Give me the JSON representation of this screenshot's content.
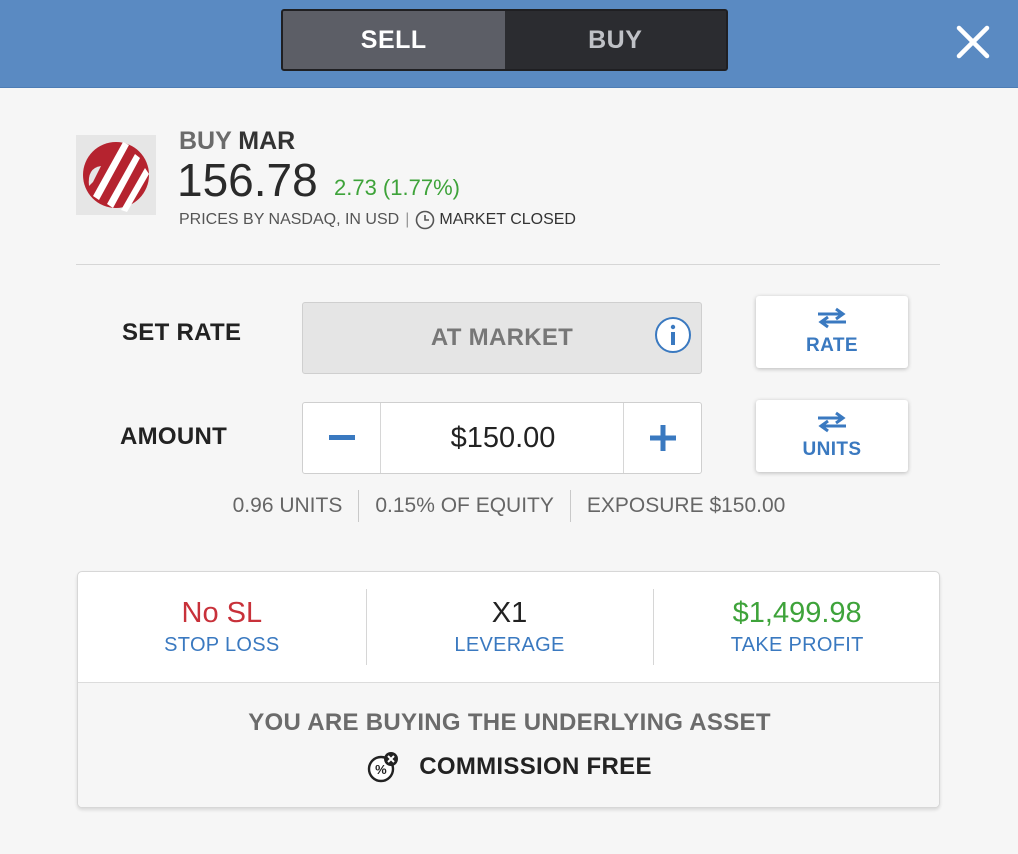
{
  "header": {
    "tabs": {
      "sell": "SELL",
      "buy": "BUY"
    }
  },
  "instrument": {
    "action": "BUY",
    "symbol": "MAR",
    "price": "156.78",
    "change": "2.73 (1.77%)",
    "prices_by": "PRICES BY NASDAQ, IN USD",
    "separator": "|",
    "market_status": "MARKET CLOSED"
  },
  "rate": {
    "label": "SET RATE",
    "value": "AT MARKET",
    "toggle_label": "RATE"
  },
  "amount": {
    "label": "AMOUNT",
    "value": "$150.00",
    "toggle_label": "UNITS"
  },
  "stats": {
    "units": "0.96 UNITS",
    "equity": "0.15% OF EQUITY",
    "exposure": "EXPOSURE $150.00"
  },
  "trade_settings": {
    "stop_loss": {
      "value": "No SL",
      "label": "STOP LOSS"
    },
    "leverage": {
      "value": "X1",
      "label": "LEVERAGE"
    },
    "take_profit": {
      "value": "$1,499.98",
      "label": "TAKE PROFIT"
    }
  },
  "footer": {
    "underlying": "YOU ARE BUYING THE UNDERLYING ASSET",
    "commission": "COMMISSION FREE"
  },
  "colors": {
    "header_bg": "#5a8ac2",
    "accent_blue": "#3a79c0",
    "positive_green": "#3ea33a",
    "stop_loss_red": "#c8313a",
    "logo_red": "#b5232f"
  },
  "icons": [
    "close-icon",
    "clock-icon",
    "info-icon",
    "swap-arrows-icon",
    "minus-icon",
    "plus-icon",
    "commission-percent-icon",
    "marriott-logo"
  ]
}
